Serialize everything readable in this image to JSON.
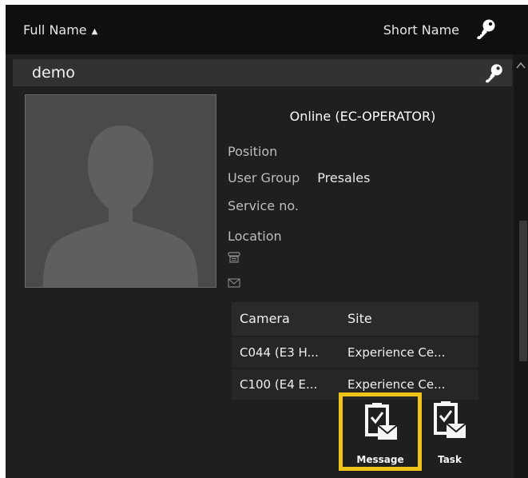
{
  "header": {
    "full_name_label": "Full Name",
    "sort_indicator": "▲",
    "short_name_label": "Short Name",
    "key_icon": "key-icon"
  },
  "selected_user": {
    "name": "demo",
    "status": "Online (EC-OPERATOR)",
    "fields": {
      "position_label": "Position",
      "user_group_label": "User Group",
      "user_group_value": "Presales",
      "service_label": "Service no.",
      "location_label": "Location"
    },
    "icons": [
      "phone-icon",
      "mail-icon"
    ]
  },
  "camera_table": {
    "headers": [
      "Camera",
      "Site"
    ],
    "rows": [
      [
        "C044 (E3 H...",
        "Experience Ce..."
      ],
      [
        "C100 (E4 E...",
        "Experience Ce..."
      ]
    ]
  },
  "actions": {
    "message_label": "Message",
    "task_label": "Task"
  },
  "colors": {
    "highlight": "#f0c419",
    "background": "#1e1e1e",
    "row_header": "#323232"
  }
}
